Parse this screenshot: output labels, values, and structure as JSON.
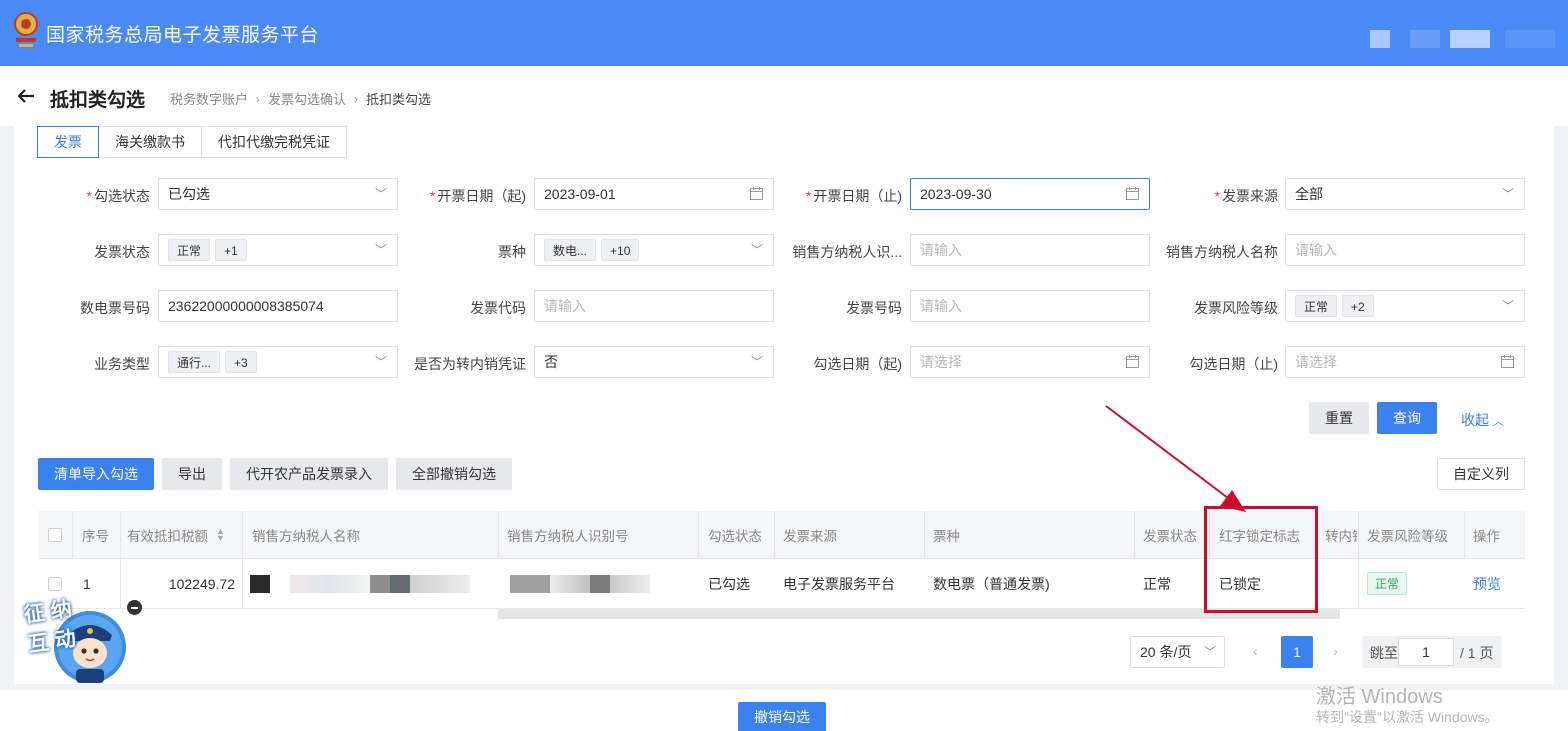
{
  "header": {
    "title": "国家税务总局电子发票服务平台"
  },
  "page": {
    "title": "抵扣类勾选",
    "breadcrumb": [
      "税务数字账户",
      "发票勾选确认",
      "抵扣类勾选"
    ]
  },
  "tabs": [
    {
      "label": "发票",
      "active": true
    },
    {
      "label": "海关缴款书",
      "active": false
    },
    {
      "label": "代扣代缴完税凭证",
      "active": false
    }
  ],
  "filters": {
    "check_status": {
      "label": "勾选状态",
      "required": true,
      "value": "已勾选"
    },
    "issue_date_start": {
      "label": "开票日期（起)",
      "required": true,
      "value": "2023-09-01"
    },
    "issue_date_end": {
      "label": "开票日期（止)",
      "required": true,
      "value": "2023-09-30"
    },
    "invoice_source": {
      "label": "发票来源",
      "required": true,
      "value": "全部"
    },
    "invoice_status": {
      "label": "发票状态",
      "tag": "正常",
      "more": "+1"
    },
    "ticket_type": {
      "label": "票种",
      "tag": "数电...",
      "more": "+10"
    },
    "seller_tax_id": {
      "label": "销售方纳税人识...",
      "placeholder": "请输入"
    },
    "seller_name": {
      "label": "销售方纳税人名称",
      "placeholder": "请输入"
    },
    "digital_number": {
      "label": "数电票号码",
      "value": "23622000000008385074"
    },
    "invoice_code": {
      "label": "发票代码",
      "placeholder": "请输入"
    },
    "invoice_number": {
      "label": "发票号码",
      "placeholder": "请输入"
    },
    "risk_level": {
      "label": "发票风险等级",
      "tag": "正常",
      "more": "+2"
    },
    "business_type": {
      "label": "业务类型",
      "tag": "通行...",
      "more": "+3"
    },
    "transfer_out": {
      "label": "是否为转内销凭证",
      "value": "否"
    },
    "check_date_start": {
      "label": "勾选日期（起)",
      "placeholder": "请选择"
    },
    "check_date_end": {
      "label": "勾选日期（止)",
      "placeholder": "请选择"
    }
  },
  "actions": {
    "reset": "重置",
    "query": "查询",
    "collapse": "收起"
  },
  "toolbar": {
    "import_check": "清单导入勾选",
    "export": "导出",
    "agri_entry": "代开农产品发票录入",
    "cancel_all": "全部撤销勾选",
    "custom_columns": "自定义列"
  },
  "table": {
    "columns": [
      "序号",
      "有效抵扣税额",
      "销售方纳税人名称",
      "销售方纳税人识别号",
      "勾选状态",
      "发票来源",
      "票种",
      "发票状态",
      "红字锁定标志",
      "转内销",
      "发票风险等级",
      "操作"
    ],
    "rows": [
      {
        "index": "1",
        "tax_amount": "102249.72",
        "check_status": "已勾选",
        "source": "电子发票服务平台",
        "ticket_type": "数电票（普通发票)",
        "status": "正常",
        "red_lock": "已锁定",
        "risk": "正常",
        "action": "预览"
      }
    ]
  },
  "pagination": {
    "page_size": "20 条/页",
    "current": "1",
    "jump_label": "跳至",
    "jump_value": "1",
    "total": "/ 1 页"
  },
  "bottom": {
    "cancel_check": "撤销勾选"
  },
  "mascot": {
    "text": "征纳互动"
  },
  "watermark": {
    "line1": "激活 Windows",
    "line2": "转到\"设置\"以激活 Windows。"
  },
  "colors": {
    "brand": "#4a8af4",
    "primary": "#3a82f0",
    "annotation": "#c8102e",
    "success": "#26a862"
  }
}
